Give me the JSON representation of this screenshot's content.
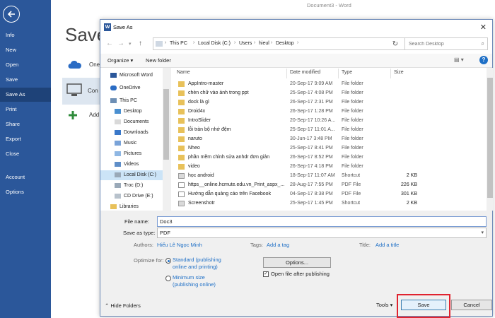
{
  "window": {
    "title": "Document3 - Word"
  },
  "backstage": {
    "title": "Save",
    "menu": [
      "Info",
      "New",
      "Open",
      "Save",
      "Save As",
      "Print",
      "Share",
      "Export",
      "Close",
      "Account",
      "Options"
    ],
    "active": "Save As",
    "locations": [
      "One",
      "Con",
      "Add"
    ]
  },
  "dialog": {
    "title": "Save As",
    "breadcrumbs": [
      "This PC",
      "Local Disk (C:)",
      "Users",
      "hieul",
      "Desktop"
    ],
    "search_placeholder": "Search Desktop",
    "toolbar": {
      "organize": "Organize ▾",
      "new_folder": "New folder"
    },
    "nav_items": [
      "Microsoft Word",
      "OneDrive",
      "This PC",
      "Desktop",
      "Documents",
      "Downloads",
      "Music",
      "Pictures",
      "Videos",
      "Local Disk (C:)",
      "Troc (D:)",
      "CD Drive (E:)",
      "Libraries"
    ],
    "nav_selected": "Local Disk (C:)",
    "columns": {
      "name": "Name",
      "date": "Date modified",
      "type": "Type",
      "size": "Size"
    },
    "files": [
      {
        "name": "AppIntro-master",
        "date": "20-Sep-17 9:09 AM",
        "type": "File folder",
        "size": "",
        "kind": "folder"
      },
      {
        "name": "chèn chữ vào ảnh trong ppt",
        "date": "25-Sep-17 4:08 PM",
        "type": "File folder",
        "size": "",
        "kind": "folder"
      },
      {
        "name": "dock là gì",
        "date": "26-Sep-17 2:31 PM",
        "type": "File folder",
        "size": "",
        "kind": "folder"
      },
      {
        "name": "Droid4x",
        "date": "26-Sep-17 1:28 PM",
        "type": "File folder",
        "size": "",
        "kind": "folder"
      },
      {
        "name": "IntroSlider",
        "date": "20-Sep-17 10:26 A...",
        "type": "File folder",
        "size": "",
        "kind": "folder"
      },
      {
        "name": "lỗi tràn bộ nhớ đệm",
        "date": "25-Sep-17 11:01 A...",
        "type": "File folder",
        "size": "",
        "kind": "folder"
      },
      {
        "name": "naruto",
        "date": "30-Jun-17 3:48 PM",
        "type": "File folder",
        "size": "",
        "kind": "folder"
      },
      {
        "name": "Nheo",
        "date": "25-Sep-17 8:41 PM",
        "type": "File folder",
        "size": "",
        "kind": "folder"
      },
      {
        "name": "phần mềm chỉnh sửa anhdr đơn giản",
        "date": "26-Sep-17 8:52 PM",
        "type": "File folder",
        "size": "",
        "kind": "folder"
      },
      {
        "name": "video",
        "date": "26-Sep-17 4:18 PM",
        "type": "File folder",
        "size": "",
        "kind": "folder"
      },
      {
        "name": "học android",
        "date": "18-Sep-17 11:07 AM",
        "type": "Shortcut",
        "size": "2 KB",
        "kind": "shortcut"
      },
      {
        "name": "https__online.hcmute.edu.vn_Print_aspx_...",
        "date": "28-Aug-17 7:55 PM",
        "type": "PDF File",
        "size": "226 KB",
        "kind": "pdf"
      },
      {
        "name": "Hướng dẫn quảng cáo trên Facebook",
        "date": "04-Sep-17 8:38 PM",
        "type": "PDF File",
        "size": "301 KB",
        "kind": "pdf"
      },
      {
        "name": "Screenshotr",
        "date": "25-Sep-17 1:45 PM",
        "type": "Shortcut",
        "size": "2 KB",
        "kind": "shortcut"
      }
    ],
    "form": {
      "file_name_label": "File name:",
      "file_name_value": "Doc3",
      "save_as_type_label": "Save as type:",
      "save_as_type_value": "PDF",
      "authors_label": "Authors:",
      "authors_value": "Hiếu Lê Ngọc Minh",
      "tags_label": "Tags:",
      "tags_value": "Add a tag",
      "title_label": "Title:",
      "title_value": "Add a title",
      "optimize_label": "Optimize for:",
      "optimize_standard": "Standard (publishing online and printing)",
      "optimize_minimum": "Minimum size (publishing online)",
      "options_button": "Options...",
      "open_after_label": "Open file after publishing",
      "open_after_checked": true
    },
    "footer": {
      "hide_folders": "Hide Folders",
      "tools": "Tools",
      "save": "Save",
      "cancel": "Cancel"
    }
  }
}
